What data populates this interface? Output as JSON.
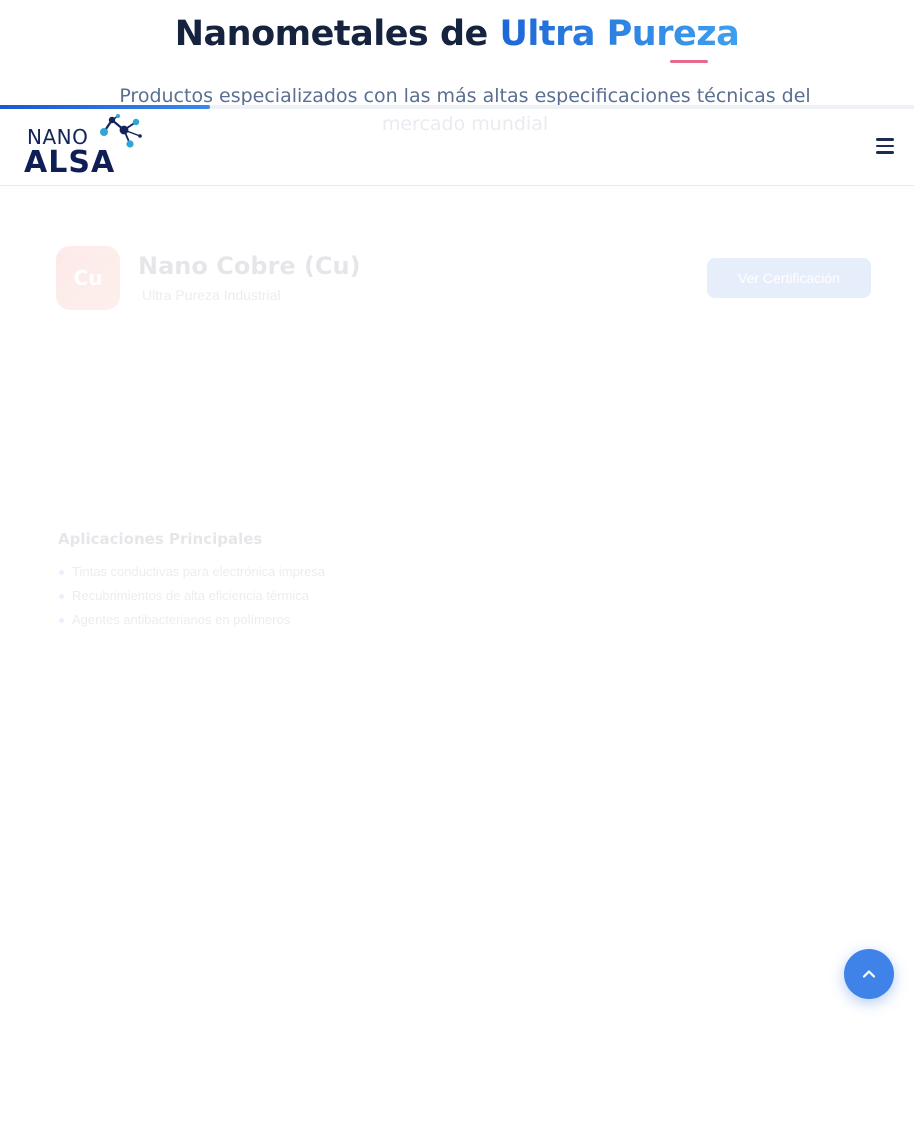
{
  "hero": {
    "title_part1": "Nanometales de ",
    "title_highlight": "Ultra Pureza",
    "subtitle": "Productos especializados con las más altas especificaciones técnicas del mercado mundial"
  },
  "scroll_progress_percent": 23,
  "header": {
    "logo": {
      "line1": "NANO",
      "line2": "ALSA"
    },
    "menu_icon": "bars-icon"
  },
  "product": {
    "icon_text": "Cu",
    "name": "Nano Cobre (Cu)",
    "tag": "Ultra Pureza Industrial",
    "download_label": "Ver Certificación",
    "applications_title": "Aplicaciones Principales",
    "applications": [
      "Tintas conductivas para electrónica impresa",
      "Recubrimientos de alta eficiencia térmica",
      "Agentes antibacterianos en polímeros"
    ]
  },
  "back_to_top_icon": "chevron-up-icon",
  "colors": {
    "accent": "#2f7fdc",
    "brand_navy": "#0f1f55",
    "back_to_top": "#3f83e8"
  }
}
